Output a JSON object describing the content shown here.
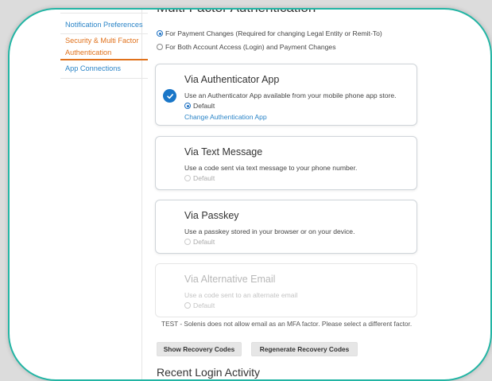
{
  "sidebar": {
    "items": [
      {
        "label": "Notification Preferences"
      },
      {
        "label": "Security & Multi Factor Authentication"
      },
      {
        "label": "App Connections"
      }
    ]
  },
  "main": {
    "heading": "Multi Factor Authentication",
    "scope_options": [
      {
        "label": "For Payment Changes (Required for changing Legal Entity or Remit-To)",
        "selected": true
      },
      {
        "label": "For Both Account Access (Login) and Payment Changes",
        "selected": false
      }
    ],
    "methods": [
      {
        "title": "Via Authenticator App",
        "description": "Use an Authenticator App available from your mobile phone app store.",
        "default_label": "Default",
        "link": "Change Authentication App"
      },
      {
        "title": "Via Text Message",
        "description": "Use a code sent via text message to your phone number.",
        "default_label": "Default"
      },
      {
        "title": "Via Passkey",
        "description": "Use a passkey stored in your browser or on your device.",
        "default_label": "Default"
      },
      {
        "title": "Via Alternative Email",
        "description": "Use a code sent to an alternate email",
        "default_label": "Default"
      }
    ],
    "note": "TEST - Solenis does not allow email as an MFA factor. Please select a different factor.",
    "buttons": {
      "show_recovery": "Show Recovery Codes",
      "regenerate_recovery": "Regenerate Recovery Codes"
    },
    "recent_heading": "Recent Login Activity"
  },
  "colors": {
    "frame_border": "#22b5a4",
    "link": "#2a84c7",
    "active": "#e0711b",
    "check": "#1976c8"
  }
}
